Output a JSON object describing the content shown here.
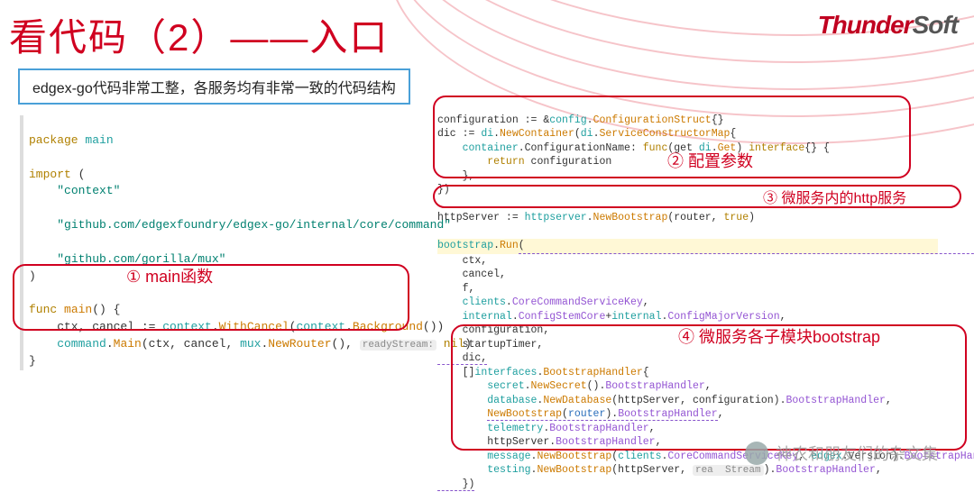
{
  "title": "看代码（2）——入口",
  "logo_main": "Thunder",
  "logo_sub": "Soft",
  "subtitle": "edgex-go代码非常工整，各服务均有非常一致的代码结构",
  "left_code": {
    "l1_kw": "package",
    "l1_id": "main",
    "l2_kw": "import",
    "l2_paren": "(",
    "l3_str": "\"context\"",
    "l4_str": "\"github.com/edgexfoundry/edgex-go/internal/core/command\"",
    "l5_str": "\"github.com/gorilla/mux\"",
    "l6_paren": ")",
    "l7_kw": "func",
    "l7_name": "main",
    "l7_sig": "() {",
    "l8": "    ctx, cancel := ",
    "l8a": "context",
    "l8b": ".",
    "l8c": "WithCancel",
    "l8d": "(",
    "l8e": "context",
    "l8f": ".",
    "l8g": "Background",
    "l8h": "())",
    "l9a": "    command",
    "l9b": ".",
    "l9c": "Main",
    "l9d": "(ctx, cancel, ",
    "l9e": "mux",
    "l9f": ".",
    "l9g": "NewRouter",
    "l9h": "(), ",
    "l9hint": "readyStream:",
    "l9nil": "nil",
    "l9end": ")",
    "l10": "}"
  },
  "annot1": "① main函数",
  "right": {
    "r1a": "configuration := &",
    "r1b": "config",
    "r1c": ".",
    "r1d": "ConfigurationStruct",
    "r1e": "{}",
    "r2a": "dic := ",
    "r2b": "di",
    "r2c": ".",
    "r2d": "NewContainer",
    "r2e": "(",
    "r2f": "di",
    "r2g": ".",
    "r2h": "ServiceConstructorMap",
    "r2i": "{",
    "r3a": "    container",
    "r3b": ".ConfigurationName: ",
    "r3c": "func",
    "r3d": "(get ",
    "r3e": "di",
    "r3f": ".",
    "r3g": "Get",
    "r3h": ") ",
    "r3i": "interface",
    "r3j": "{} {",
    "r4a": "        ",
    "r4b": "return",
    "r4c": " configuration",
    "r5": "    },",
    "r6": "})",
    "r7a": "httpServer := ",
    "r7b": "httpserver",
    "r7c": ".",
    "r7d": "NewBootstrap",
    "r7e": "(router, ",
    "r7f": "true",
    "r7g": ")",
    "r8a": "bootstrap",
    "r8b": ".",
    "r8c": "Run",
    "r8d": "(",
    "r9": "    ctx,",
    "r10": "    cancel,",
    "r11": "    f,",
    "r12a": "    clients",
    "r12b": ".",
    "r12c": "CoreCommandServiceKey",
    "r12d": ",",
    "r13a": "    internal",
    "r13b": ".",
    "r13c": "ConfigStemCore",
    "r13d": "+",
    "r13e": "internal",
    "r13f": ".",
    "r13g": "ConfigMajorVersion",
    "r13h": ",",
    "r14": "    configuration,",
    "r15": "    startupTimer,",
    "r16": "    dic,",
    "r17a": "    []",
    "r17b": "interfaces",
    "r17c": ".",
    "r17d": "BootstrapHandler",
    "r17e": "{",
    "r18a": "        secret",
    "r18b": ".",
    "r18c": "NewSecret",
    "r18d": "().",
    "r18e": "BootstrapHandler",
    "r18f": ",",
    "r19a": "        database",
    "r19b": ".",
    "r19c": "NewDatabase",
    "r19d": "(httpServer, configuration).",
    "r19e": "BootstrapHandler",
    "r19f": ",",
    "r20a": "        ",
    "r20b": "NewBootstrap",
    "r20c": "(",
    "r20d": "router",
    "r20e": ").",
    "r20f": "BootstrapHandler",
    "r20g": ",",
    "r21a": "        telemetry",
    "r21b": ".",
    "r21c": "BootstrapHandler",
    "r21d": ",",
    "r22a": "        httpServer",
    "r22b": ".",
    "r22c": "BootstrapHandler",
    "r22d": ",",
    "r23a": "        message",
    "r23b": ".",
    "r23c": "NewBootstrap",
    "r23d": "(",
    "r23e": "clients",
    "r23f": ".",
    "r23g": "CoreCommandServiceKey",
    "r23h": ", ",
    "r23i": "edgex",
    "r23j": ".Version).",
    "r23k": "BootstrapHandler",
    "r23l": ",",
    "r24a": "        testing",
    "r24b": ".",
    "r24c": "NewBootstrap",
    "r24d": "(httpServer, ",
    "r24hint": "rea  Stream",
    "r24e": ").",
    "r24f": "BootstrapHandler",
    "r24g": ",",
    "r25": "    })"
  },
  "annot2": "② 配置参数",
  "annot3": "③ 微服务内的http服务",
  "annot4": "④ 微服务各子模块bootstrap",
  "watermark": "神农和朋友们的杂文集"
}
